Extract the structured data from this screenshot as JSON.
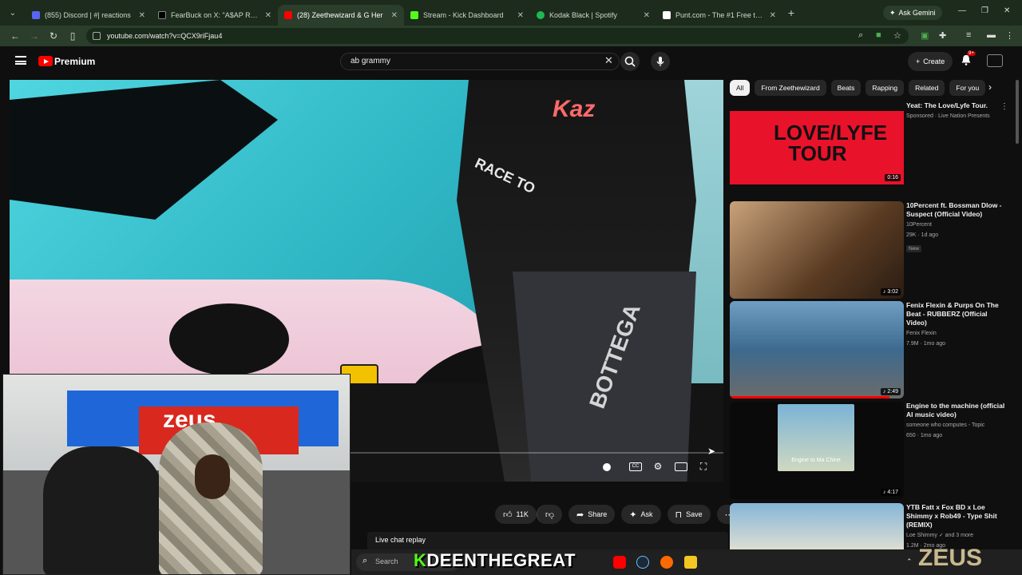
{
  "browser": {
    "tabs": [
      {
        "title": "(855) Discord | #​| reactions",
        "favicon_color": "#5865F2",
        "active": false
      },
      {
        "title": "FearBuck on X: \"A$AP Rocky g",
        "favicon_color": "#000000",
        "active": false
      },
      {
        "title": "(28) Zeethewizard & G Her",
        "favicon_color": "#ff0000",
        "active": true
      },
      {
        "title": "Stream - Kick Dashboard",
        "favicon_color": "#53fc18",
        "active": false
      },
      {
        "title": "Kodak Black | Spotify",
        "favicon_color": "#1db954",
        "active": false
      },
      {
        "title": "Punt.com - The #1 Free to Play",
        "favicon_color": "#ffffff",
        "active": false
      }
    ],
    "ask_gemini": "Ask Gemini",
    "url": "youtube.com/watch?v=QCX9riFjau4"
  },
  "youtube": {
    "brand": "Premium",
    "search_query": "ab grammy",
    "create_label": "Create",
    "notification_count": "9+",
    "chips": [
      "All",
      "From Zeethewizard",
      "Beats",
      "Rapping",
      "Related",
      "For you"
    ],
    "actions": {
      "like_count": "11K",
      "share": "Share",
      "ask": "Ask",
      "save": "Save"
    },
    "live_chat": "Live chat replay",
    "recommendations": [
      {
        "title": "Yeat: The Love/Lyfe Tour.",
        "channel": "Sponsored · Live Nation Presents",
        "stats": "",
        "duration": "0:16",
        "badge": "",
        "thumb_color": "#e8122b",
        "thumb_text": "LOVE/LYFE TOUR"
      },
      {
        "title": "10Percent ft. Bossman Dlow - Suspect (Official Video)",
        "channel": "10Percent",
        "stats": "29K · 1d ago",
        "duration": "3:02",
        "badge": "New",
        "thumb_color": "#6b4a2a",
        "thumb_text": ""
      },
      {
        "title": "Fenix Flexin & Purps On The Beat - RUBBERZ (Official Video)",
        "channel": "Fenix Flexin",
        "stats": "7.9M · 1mo ago",
        "duration": "2:49",
        "badge": "",
        "thumb_color": "#4c7da6",
        "thumb_text": ""
      },
      {
        "title": "Engine to the machine (official AI music video)",
        "channel": "someone who computes - Topic",
        "stats": "650 · 1mo ago",
        "duration": "4:17",
        "badge": "",
        "thumb_color": "#0a0a0a",
        "thumb_text": "Engine to Ma Chine"
      },
      {
        "title": "YTB Fatt x Fox BD x Loe Shimmy x Rob49 - Type Shit (REMIX)",
        "channel": "Loe Shimmy ✓ and 3 more",
        "stats": "1.2M · 2mo ago",
        "duration": "",
        "badge": "",
        "thumb_color": "#6fa2c9",
        "thumb_text": ""
      }
    ]
  },
  "video": {
    "overlay_text_1": "RACE TO",
    "overlay_text_2": "BOTTEGA",
    "overlay_text_3": "Kaz"
  },
  "webcam": {
    "banner_text": "zeus"
  },
  "taskbar": {
    "search_placeholder": "Search",
    "streamer_name_k": "K",
    "streamer_name": "DEENTHEGREAT",
    "watermark": "ZEUS"
  }
}
